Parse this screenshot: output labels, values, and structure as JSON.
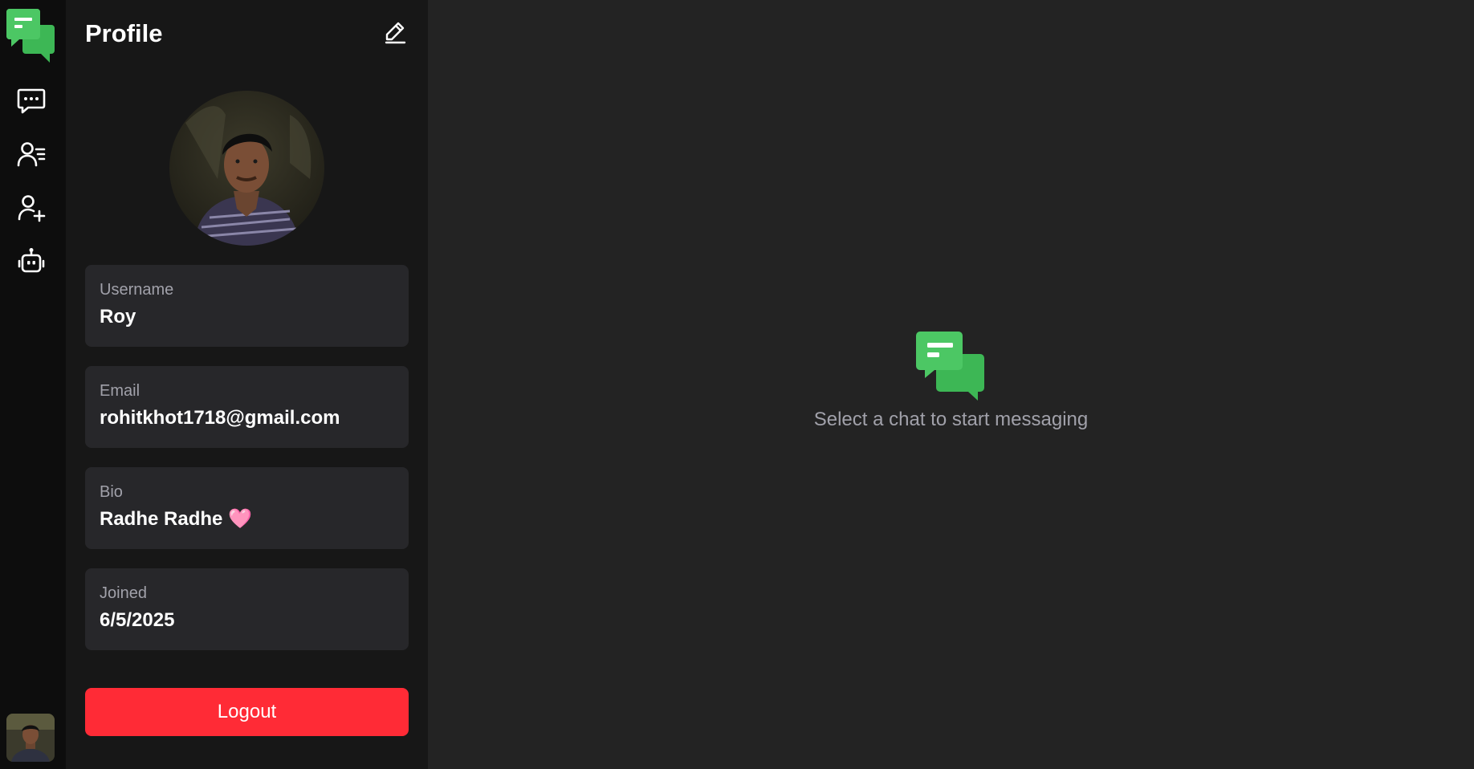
{
  "app": {
    "accent": "#4cc764",
    "danger": "#ff2b36"
  },
  "rail": {
    "logo": "chat-bubbles-logo",
    "items": [
      {
        "icon": "chat-icon"
      },
      {
        "icon": "contacts-list-icon"
      },
      {
        "icon": "add-user-icon"
      },
      {
        "icon": "bot-icon"
      }
    ],
    "avatar": "user-avatar"
  },
  "profile": {
    "title": "Profile",
    "edit_icon": "edit-pencil-icon",
    "fields": [
      {
        "label": "Username",
        "value": "Roy"
      },
      {
        "label": "Email",
        "value": "rohitkhot1718@gmail.com"
      },
      {
        "label": "Bio",
        "value": "Radhe Radhe 🩷"
      },
      {
        "label": "Joined",
        "value": "6/5/2025"
      }
    ],
    "logout_label": "Logout"
  },
  "main": {
    "empty_message": "Select a chat to start messaging",
    "empty_icon": "chat-bubbles-logo"
  }
}
